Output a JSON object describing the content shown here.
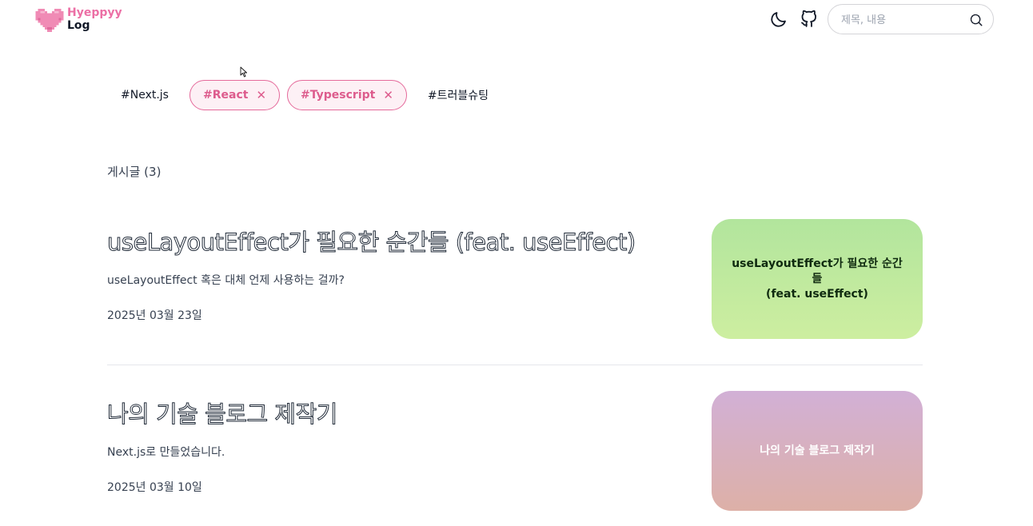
{
  "header": {
    "logo_line1": "Hyeppyy",
    "logo_line2": "Log",
    "logo_icon": "pixel-heart-icon",
    "theme_icon": "moon-icon",
    "github_icon": "github-icon",
    "search": {
      "placeholder": "제목, 내용",
      "value": "",
      "icon": "search-icon"
    }
  },
  "colors": {
    "accent": "#e56a9b",
    "accent_bg": "#fdf0f5"
  },
  "tags": [
    {
      "label": "#Next.js",
      "selected": false
    },
    {
      "label": "#React",
      "selected": true,
      "remove": "✕"
    },
    {
      "label": "#Typescript",
      "selected": true,
      "remove": "✕"
    },
    {
      "label": "#트러블슈팅",
      "selected": false
    }
  ],
  "post_count_label": "게시글 (3)",
  "posts": [
    {
      "title": "useLayoutEffect가 필요한 순간들 (feat. useEffect)",
      "description": "useLayoutEffect 혹은 대체 언제 사용하는 걸까?",
      "date": "2025년 03월 23일",
      "thumbnail_line1": "useLayoutEffect가 필요한 순간들",
      "thumbnail_line2": "(feat. useEffect)"
    },
    {
      "title": "나의 기술 블로그 제작기",
      "description": "Next.js로 만들었습니다.",
      "date": "2025년 03월 10일",
      "thumbnail_line1": "나의 기술 블로그 제작기"
    }
  ]
}
